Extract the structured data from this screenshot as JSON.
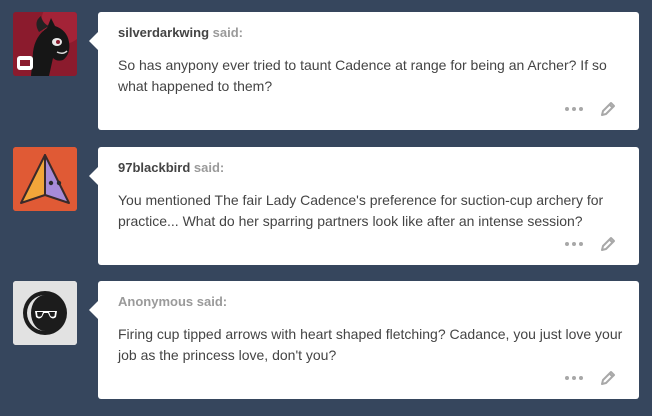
{
  "posts": [
    {
      "asker": "silverdarkwing",
      "said": "said:",
      "question": "So has anypony ever tried to taunt Cadence at range for being an Archer? If so what happened to them?",
      "avatar_icon": "black-pony-avatar-icon"
    },
    {
      "asker": "97blackbird",
      "said": "said:",
      "question": "You mentioned The fair Lady Cadence's preference for suction-cup archery for practice... What do her sparring partners look like after an intense session?",
      "avatar_icon": "pyramid-avatar-icon"
    },
    {
      "asker": "Anonymous",
      "said": "said:",
      "question": "Firing cup tipped arrows with heart shaped fletching? Cadance, you just love your job as the princess love, don't you?",
      "avatar_icon": "sunglasses-avatar-icon"
    }
  ],
  "colors": {
    "background": "#36465d",
    "card": "#ffffff",
    "text": "#444444",
    "muted": "#9a9a9a",
    "avatar2_bg": "#e05a35",
    "avatar3_bg": "#e2e2e2"
  }
}
